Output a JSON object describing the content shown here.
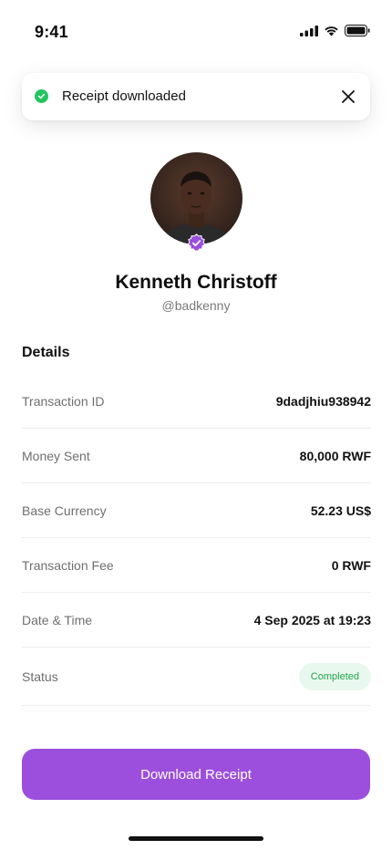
{
  "status_bar": {
    "time": "9:41",
    "icons": [
      "cellular-signal-icon",
      "wifi-icon",
      "battery-icon"
    ]
  },
  "toast": {
    "message": "Receipt downloaded",
    "status_color": "#22c55e",
    "icon": "close-icon"
  },
  "profile": {
    "name": "Kenneth Christoff",
    "handle": "@badkenny",
    "badge_icon": "verified-badge-icon",
    "badge_color": "#9b4fdc"
  },
  "details": {
    "title": "Details",
    "rows": [
      {
        "label": "Transaction ID",
        "value": "9dadjhiu938942"
      },
      {
        "label": "Money Sent",
        "value": "80,000 RWF"
      },
      {
        "label": "Base Currency",
        "value": "52.23 US$"
      },
      {
        "label": "Transaction Fee",
        "value": "0 RWF"
      },
      {
        "label": "Date & Time",
        "value": "4 Sep 2025 at 19:23"
      },
      {
        "label": "Status",
        "value": "Completed"
      }
    ]
  },
  "actions": {
    "download_label": "Download Receipt",
    "accent_color": "#9b4fdc"
  }
}
